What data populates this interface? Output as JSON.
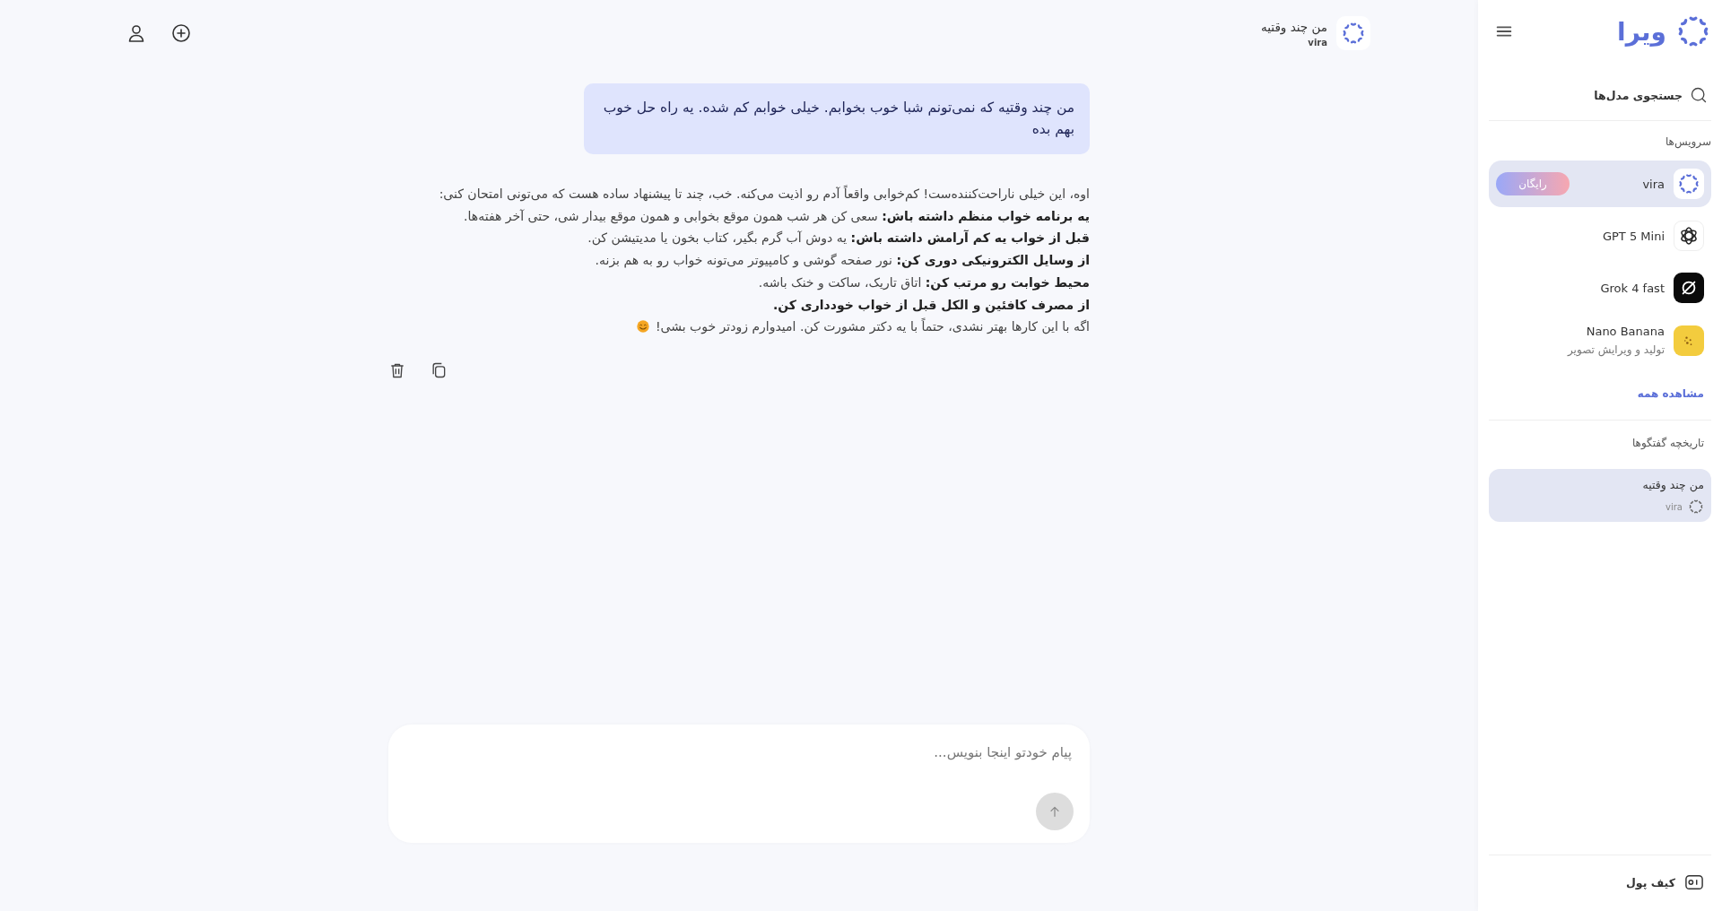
{
  "sidebar": {
    "logo": "ویرا",
    "search": {
      "label": "جستجوی مدل‌ها"
    },
    "services_title": "سرویس‌ها",
    "services": [
      {
        "kind": "vira",
        "name": "vira",
        "badge": "رایگان",
        "selected": true
      },
      {
        "kind": "gpt",
        "name": "GPT 5 Mini",
        "selected": false
      },
      {
        "kind": "grok",
        "name": "Grok 4 fast",
        "selected": false
      },
      {
        "kind": "banana",
        "name": "Nano Banana",
        "subtitle": "تولید و ویرایش تصویر",
        "selected": false
      }
    ],
    "see_all": "مشاهده همه",
    "history_title": "تاریخچه گفتگوها",
    "history": [
      {
        "title": "من چند وقتیه",
        "model": "vira",
        "selected": true
      }
    ],
    "wallet": "کیف پول"
  },
  "header": {
    "title": "من چند وقتیه",
    "model": "vira"
  },
  "messages": [
    {
      "kind": "user",
      "text": "من چند وقتیه که نمی‌تونم شبا خوب بخوابم. خیلی خوابم کم شده. یه راه حل خوب بهم بده"
    },
    {
      "kind": "assistant",
      "lines": [
        {
          "text": "اوه، این خیلی ناراحت‌کننده‌ست! کم‌خوابی واقعاً آدم رو اذیت می‌کنه. خب، چند تا پیشنهاد ساده هست که می‌تونی امتحان کنی:"
        },
        {
          "text": "**یه برنامه خواب منظم داشته باش:** سعی کن هر شب همون موقع بخوابی و همون موقع بیدار شی، حتی آخر هفته‌ها."
        },
        {
          "text": "**قبل از خواب یه کم آرامش داشته باش:** یه دوش آب گرم بگیر، کتاب بخون یا مدیتیشن کن."
        },
        {
          "text": "**از وسایل الکترونیکی دوری کن:** نور صفحه گوشی و کامپیوتر می‌تونه خواب رو به هم بزنه."
        },
        {
          "text": "**محیط خوابت رو مرتب کن:** اتاق تاریک، ساکت و خنک باشه."
        },
        {
          "text": "از مصرف کافئین و الکل قبل از خواب خودداری کن.",
          "bold": true
        },
        {
          "text": "اگه با این کارها بهتر نشدی، حتماً با یه دکتر مشورت کن. امیدوارم زودتر خوب بشی!",
          "smile": true
        }
      ]
    }
  ],
  "composer": {
    "placeholder": "پیام خودتو اینجا بنویس..."
  }
}
